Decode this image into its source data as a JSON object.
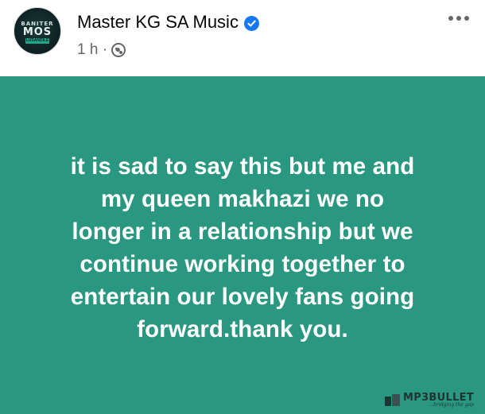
{
  "post": {
    "page_name": "Master KG SA Music",
    "verified": true,
    "timestamp": "1 h ·",
    "privacy_icon": "globe-icon",
    "more_icon": "ellipsis-icon",
    "avatar": {
      "text_top": "BANITER",
      "text_main": "MOS",
      "text_bottom": "LUSANDILE"
    },
    "background_color": "#2a9880",
    "text": "it is sad to say this but me and my queen makhazi we no longer in a relationship but we continue working together to entertain our lovely fans going forward.thank you.",
    "lines": [
      "it is sad to say this but me and",
      "my queen makhazi we no",
      "longer in a relationship but we",
      "continue working together to",
      "entertain our lovely fans going",
      "forward.thank you."
    ]
  },
  "watermark": {
    "title": "MP3BULLET",
    "subtitle": "...bridging the gap"
  },
  "colors": {
    "verified_badge": "#1877f2",
    "secondary_text": "#65676b",
    "primary_text": "#050505"
  }
}
